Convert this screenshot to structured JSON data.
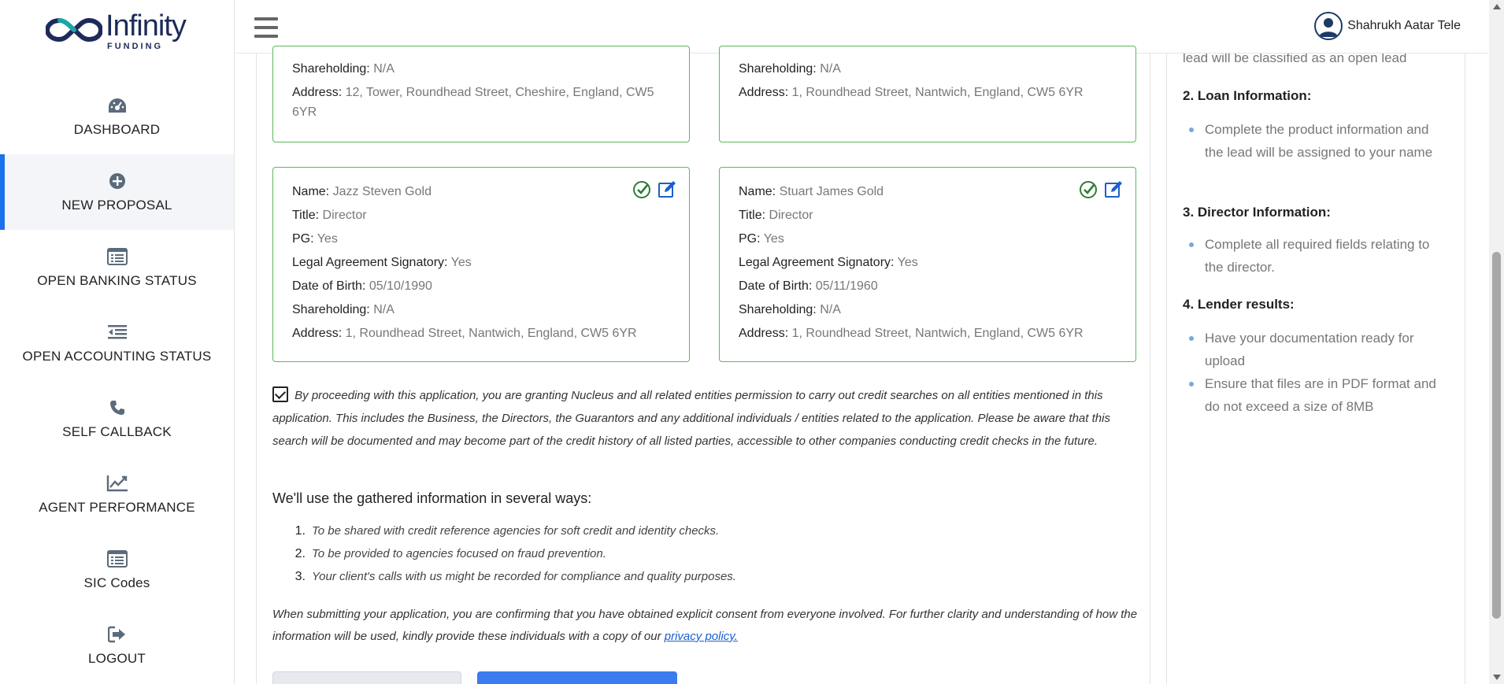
{
  "app": {
    "logo_text": "Infinity",
    "logo_sub": "FUNDING",
    "brand_colors": {
      "navy": "#1d2b5a",
      "teal": "#1aa6a6",
      "accent": "#1a73e8",
      "card_border": "#5cb85c"
    }
  },
  "sidebar": {
    "items": [
      {
        "label": "DASHBOARD",
        "icon": "dashboard-icon"
      },
      {
        "label": "NEW PROPOSAL",
        "icon": "plus-circle-icon",
        "active": true
      },
      {
        "label": "OPEN BANKING STATUS",
        "icon": "list-icon"
      },
      {
        "label": "OPEN ACCOUNTING STATUS",
        "icon": "indent-list-icon"
      },
      {
        "label": "SELF CALLBACK",
        "icon": "phone-icon"
      },
      {
        "label": "AGENT PERFORMANCE",
        "icon": "chart-line-icon"
      },
      {
        "label": "SIC Codes",
        "icon": "list-icon"
      },
      {
        "label": "LOGOUT",
        "icon": "logout-icon"
      }
    ]
  },
  "header": {
    "user_name": "Shahrukh Aatar Tele"
  },
  "labels": {
    "name": "Name:",
    "title": "Title:",
    "pg": "PG:",
    "legal": "Legal Agreement Signatory:",
    "dob": "Date of Birth:",
    "shareholding": "Shareholding:",
    "address": "Address:"
  },
  "directors_top": [
    {
      "shareholding": "N/A",
      "address": "12, Tower, Roundhead Street, Cheshire, England, CW5 6YR"
    },
    {
      "shareholding": "N/A",
      "address": "1, Roundhead Street, Nantwich, England, CW5 6YR"
    }
  ],
  "directors": [
    {
      "name": "Jazz Steven Gold",
      "title": "Director",
      "pg": "Yes",
      "legal": "Yes",
      "dob": "05/10/1990",
      "shareholding": "N/A",
      "address": "1, Roundhead Street, Nantwich, England, CW5 6YR"
    },
    {
      "name": "Stuart James Gold",
      "title": "Director",
      "pg": "Yes",
      "legal": "Yes",
      "dob": "05/11/1960",
      "shareholding": "N/A",
      "address": "1, Roundhead Street, Nantwich, England, CW5 6YR"
    }
  ],
  "consent": {
    "checked": true,
    "text": "By proceeding with this application, you are granting Nucleus and all related entities permission to carry out credit searches on all entities mentioned in this application. This includes the Business, the Directors, the Guarantors and any additional individuals / entities related to the application. Please be aware that this search will be documented and may become part of the credit history of all listed parties, accessible to other companies conducting credit checks in the future."
  },
  "usage": {
    "title": "We'll use the gathered information in several ways:",
    "items": [
      {
        "num": "1.",
        "text": "To be shared with credit reference agencies for soft credit and identity checks."
      },
      {
        "num": "2.",
        "text": "To be provided to agencies focused on fraud prevention."
      },
      {
        "num": "3.",
        "text": "Your client's calls with us might be recorded for compliance and quality purposes."
      }
    ]
  },
  "final": {
    "text": "When submitting your application, you are confirming that you have obtained explicit consent from everyone involved. For further clarity and understanding of how the information will be used, kindly provide these individuals with a copy of our ",
    "link": "privacy policy."
  },
  "side_panel": {
    "clipped_text": "lead will be classified as an open lead",
    "sections": [
      {
        "heading": "2. Loan Information:",
        "bullets": [
          "Complete the product information and the lead will be assigned to your name"
        ]
      },
      {
        "heading": "3. Director Information:",
        "bullets": [
          "Complete all required fields relating to the director."
        ]
      },
      {
        "heading": "4. Lender results:",
        "bullets": [
          "Have your documentation ready for upload",
          "Ensure that files are in PDF format and do not exceed a size of 8MB"
        ]
      }
    ]
  }
}
